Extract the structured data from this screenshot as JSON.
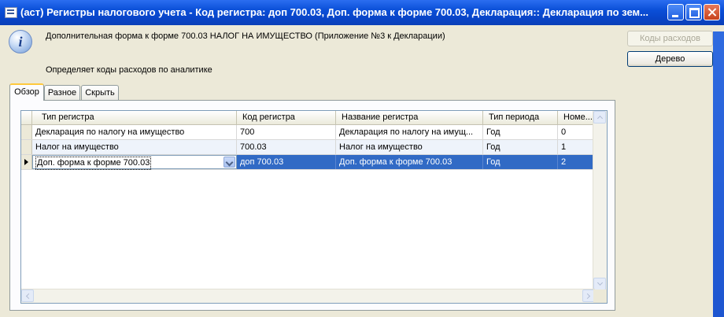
{
  "window": {
    "title": "(аст) Регистры налогового учета - Код регистра: доп 700.03, Доп. форма к форме 700.03, Декларация:: Декларация по зем..."
  },
  "info": {
    "description": "Дополнительная форма к форме 700.03 НАЛОГ НА ИМУЩЕСТВО (Приложение №3 к Декларации)",
    "subtext": "Определяет коды расходов по аналитике"
  },
  "buttons": {
    "codes": "Коды расходов",
    "tree": "Дерево"
  },
  "tabs": [
    {
      "label": "Обзор",
      "active": true
    },
    {
      "label": "Разное",
      "active": false
    },
    {
      "label": "Скрыть",
      "active": false
    }
  ],
  "grid": {
    "columns": [
      "Тип регистра",
      "Код регистра",
      "Название регистра",
      "Тип периода",
      "Номе..."
    ],
    "rows": [
      [
        "Декларация по налогу на имущество",
        "700",
        "Декларация по налогу на имущ...",
        "Год",
        "0"
      ],
      [
        "Налог на имущество",
        "700.03",
        "Налог на имущество",
        "Год",
        "1"
      ],
      [
        "Доп. форма к форме 700.03",
        "доп 700.03",
        "Доп. форма к форме 700.03",
        "Год",
        "2"
      ]
    ],
    "selected_row": 2
  }
}
